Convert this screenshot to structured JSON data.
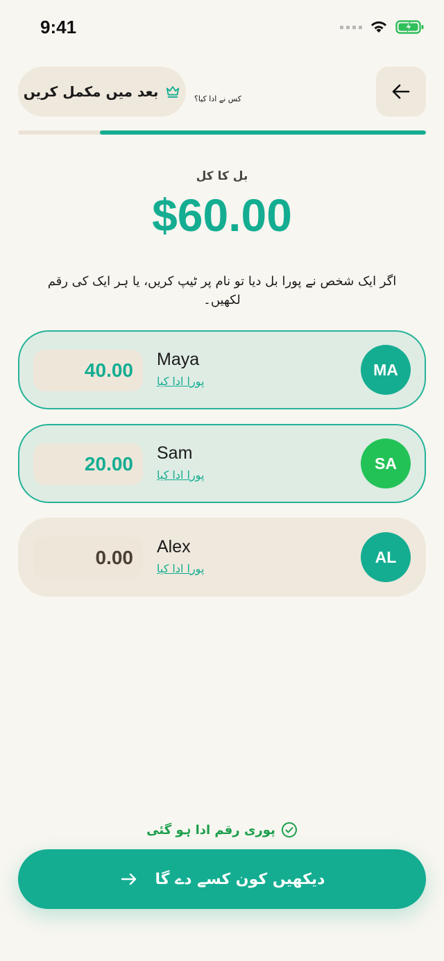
{
  "status": {
    "time": "9:41"
  },
  "header": {
    "finish_later": "بعد میں مکمل کریں",
    "title": "کس نے ادا کیا؟"
  },
  "progress": {
    "value": 0.8
  },
  "bill": {
    "total_label": "بل کا کل",
    "total_amount": "$60.00",
    "instructions": "اگر ایک شخص نے پورا بل دیا تو نام پر ٹیپ کریں، یا ہر ایک کی رقم لکھیں۔"
  },
  "people": [
    {
      "name": "Maya",
      "initials": "MA",
      "amount": "40.00",
      "paid_full_label": "پورا ادا کیا",
      "avatar_color": "#14ad92"
    },
    {
      "name": "Sam",
      "initials": "SA",
      "amount": "20.00",
      "paid_full_label": "پورا ادا کیا",
      "avatar_color": "#23c257"
    },
    {
      "name": "Alex",
      "initials": "AL",
      "amount": "0.00",
      "paid_full_label": "پورا ادا کیا",
      "avatar_color": "#14ad92"
    }
  ],
  "footer": {
    "fully_paid": "پوری رقم ادا ہو گئی",
    "cta": "دیکھیں کون کسے دے گا"
  },
  "icons": {
    "back": "arrow-left-icon",
    "crown": "crown-icon",
    "check": "check-circle-icon",
    "cta_arrow": "arrow-right-icon"
  },
  "colors": {
    "accent": "#14ad92",
    "background": "#f8f6f0",
    "surface": "#efe8dc",
    "success": "#1a9e4a"
  }
}
